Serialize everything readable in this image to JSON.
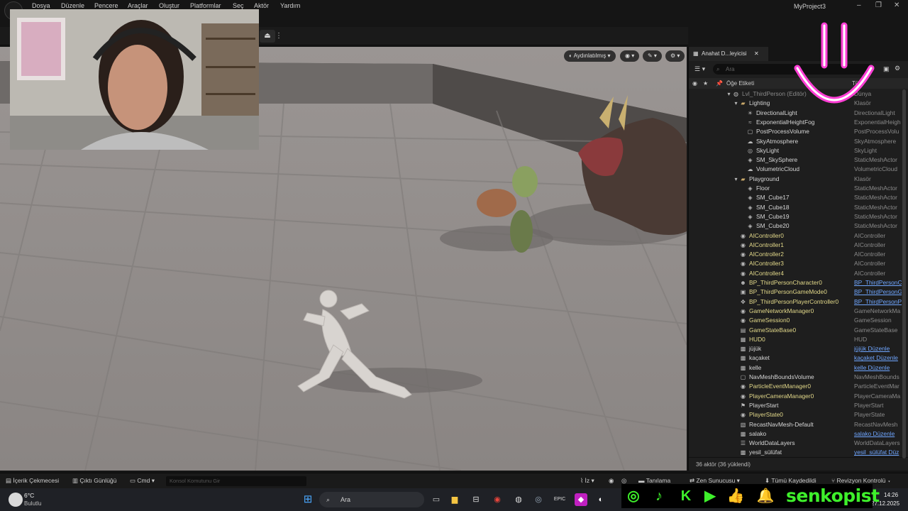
{
  "menubar": {
    "items": [
      "Dosya",
      "Düzenle",
      "Pencere",
      "Araçlar",
      "Oluştur",
      "Platformlar",
      "Seç",
      "Aktör",
      "Yardım"
    ],
    "project": "MyProject3"
  },
  "viewport": {
    "lighting": "Aydınlatılmış"
  },
  "outliner": {
    "tab": "Anahat D...leyicisi",
    "search_placeholder": "Ara",
    "col_label": "Öğe Etiketi",
    "col_type": "Tür",
    "rows": [
      {
        "label": "Lvl_ThirdPerson (Editör)",
        "type": "Dünya",
        "depth": 0,
        "icon": "world-icon",
        "yellow": false,
        "link": false,
        "dim": true
      },
      {
        "label": "Lighting",
        "type": "Klasör",
        "depth": 1,
        "icon": "folder-icon",
        "yellow": false,
        "link": false
      },
      {
        "label": "DirectionalLight",
        "type": "DirectionalLight",
        "depth": 2,
        "icon": "sun-icon",
        "yellow": false,
        "link": false
      },
      {
        "label": "ExponentialHeightFog",
        "type": "ExponentialHeigh",
        "depth": 2,
        "icon": "fog-icon",
        "yellow": false,
        "link": false
      },
      {
        "label": "PostProcessVolume",
        "type": "PostProcessVolu",
        "depth": 2,
        "icon": "volume-icon",
        "yellow": false,
        "link": false
      },
      {
        "label": "SkyAtmosphere",
        "type": "SkyAtmosphere",
        "depth": 2,
        "icon": "sky-icon",
        "yellow": false,
        "link": false
      },
      {
        "label": "SkyLight",
        "type": "SkyLight",
        "depth": 2,
        "icon": "skylight-icon",
        "yellow": false,
        "link": false
      },
      {
        "label": "SM_SkySphere",
        "type": "StaticMeshActor",
        "depth": 2,
        "icon": "mesh-icon",
        "yellow": false,
        "link": false
      },
      {
        "label": "VolumetricCloud",
        "type": "VolumetricCloud",
        "depth": 2,
        "icon": "cloud-icon",
        "yellow": false,
        "link": false
      },
      {
        "label": "Playground",
        "type": "Klasör",
        "depth": 1,
        "icon": "folder-icon",
        "yellow": false,
        "link": false
      },
      {
        "label": "Floor",
        "type": "StaticMeshActor",
        "depth": 2,
        "icon": "mesh-icon",
        "yellow": false,
        "link": false
      },
      {
        "label": "SM_Cube17",
        "type": "StaticMeshActor",
        "depth": 2,
        "icon": "mesh-icon",
        "yellow": false,
        "link": false
      },
      {
        "label": "SM_Cube18",
        "type": "StaticMeshActor",
        "depth": 2,
        "icon": "mesh-icon",
        "yellow": false,
        "link": false
      },
      {
        "label": "SM_Cube19",
        "type": "StaticMeshActor",
        "depth": 2,
        "icon": "mesh-icon",
        "yellow": false,
        "link": false
      },
      {
        "label": "SM_Cube20",
        "type": "StaticMeshActor",
        "depth": 2,
        "icon": "mesh-icon",
        "yellow": false,
        "link": false
      },
      {
        "label": "AIController0",
        "type": "AIController",
        "depth": 1,
        "icon": "controller-icon",
        "yellow": true,
        "link": false
      },
      {
        "label": "AIController1",
        "type": "AIController",
        "depth": 1,
        "icon": "controller-icon",
        "yellow": true,
        "link": false
      },
      {
        "label": "AIController2",
        "type": "AIController",
        "depth": 1,
        "icon": "controller-icon",
        "yellow": true,
        "link": false
      },
      {
        "label": "AIController3",
        "type": "AIController",
        "depth": 1,
        "icon": "controller-icon",
        "yellow": true,
        "link": false
      },
      {
        "label": "AIController4",
        "type": "AIController",
        "depth": 1,
        "icon": "controller-icon",
        "yellow": true,
        "link": false
      },
      {
        "label": "BP_ThirdPersonCharacter0",
        "type": "BP_ThirdPersonC",
        "depth": 1,
        "icon": "character-icon",
        "yellow": true,
        "link": true
      },
      {
        "label": "BP_ThirdPersonGameMode0",
        "type": "BP_ThirdPersonG",
        "depth": 1,
        "icon": "gamemode-icon",
        "yellow": true,
        "link": true
      },
      {
        "label": "BP_ThirdPersonPlayerController0",
        "type": "BP_ThirdPersonP",
        "depth": 1,
        "icon": "gamepad-icon",
        "yellow": true,
        "link": true
      },
      {
        "label": "GameNetworkManager0",
        "type": "GameNetworkMa",
        "depth": 1,
        "icon": "controller-icon",
        "yellow": true,
        "link": false
      },
      {
        "label": "GameSession0",
        "type": "GameSession",
        "depth": 1,
        "icon": "controller-icon",
        "yellow": true,
        "link": false
      },
      {
        "label": "GameStateBase0",
        "type": "GameStateBase",
        "depth": 1,
        "icon": "gamestate-icon",
        "yellow": true,
        "link": false
      },
      {
        "label": "HUD0",
        "type": "HUD",
        "depth": 1,
        "icon": "hud-icon",
        "yellow": true,
        "link": false
      },
      {
        "label": "jüjük",
        "type": "jüjük Düzenle",
        "depth": 1,
        "icon": "actor-icon",
        "yellow": false,
        "link": true
      },
      {
        "label": "kaçaket",
        "type": "kaçaket Düzenle",
        "depth": 1,
        "icon": "actor-icon",
        "yellow": false,
        "link": true
      },
      {
        "label": "kelle",
        "type": "kelle Düzenle",
        "depth": 1,
        "icon": "actor-icon",
        "yellow": false,
        "link": true
      },
      {
        "label": "NavMeshBoundsVolume",
        "type": "NavMeshBounds",
        "depth": 1,
        "icon": "volume-icon",
        "yellow": false,
        "link": false
      },
      {
        "label": "ParticleEventManager0",
        "type": "ParticleEventMar",
        "depth": 1,
        "icon": "controller-icon",
        "yellow": true,
        "link": false
      },
      {
        "label": "PlayerCameraManager0",
        "type": "PlayerCameraMa",
        "depth": 1,
        "icon": "controller-icon",
        "yellow": true,
        "link": false
      },
      {
        "label": "PlayerStart",
        "type": "PlayerStart",
        "depth": 1,
        "icon": "playerstart-icon",
        "yellow": false,
        "link": false
      },
      {
        "label": "PlayerState0",
        "type": "PlayerState",
        "depth": 1,
        "icon": "controller-icon",
        "yellow": true,
        "link": false
      },
      {
        "label": "RecastNavMesh-Default",
        "type": "RecastNavMesh",
        "depth": 1,
        "icon": "navmesh-icon",
        "yellow": false,
        "link": false
      },
      {
        "label": "salako",
        "type": "salako Düzenle",
        "depth": 1,
        "icon": "actor-icon",
        "yellow": false,
        "link": true
      },
      {
        "label": "WorldDataLayers",
        "type": "WorldDataLayers",
        "depth": 1,
        "icon": "layers-icon",
        "yellow": false,
        "link": false
      },
      {
        "label": "yesil_sülüfat",
        "type": "yesil_sülüfat Düz",
        "depth": 1,
        "icon": "actor-icon",
        "yellow": false,
        "link": true
      }
    ],
    "status": "36 aktör (36 yüklendi)"
  },
  "bottombar": {
    "content_drawer": "İçerik Çekmecesi",
    "output_log": "Çıktı Günlüğü",
    "cmd": "Cmd",
    "console_placeholder": "Konsol Komutunu Gir",
    "trace": "İz",
    "derive": "Tanılama",
    "zen": "Zen Sunucusu",
    "save_all": "Tümü Kaydedildi",
    "revision": "Revizyon Kontrolü"
  },
  "taskbar": {
    "temp": "6°C",
    "weather": "Bulutlu",
    "search": "Ara",
    "time": "14:26",
    "date": "27.12.2025"
  },
  "overlay": {
    "channel": "senkopist"
  },
  "colors": {
    "accent_green": "#3ef02b",
    "smile_pink": "#ff3fd6",
    "yellow_text": "#e3d98a",
    "link_blue": "#6fa6ff"
  }
}
